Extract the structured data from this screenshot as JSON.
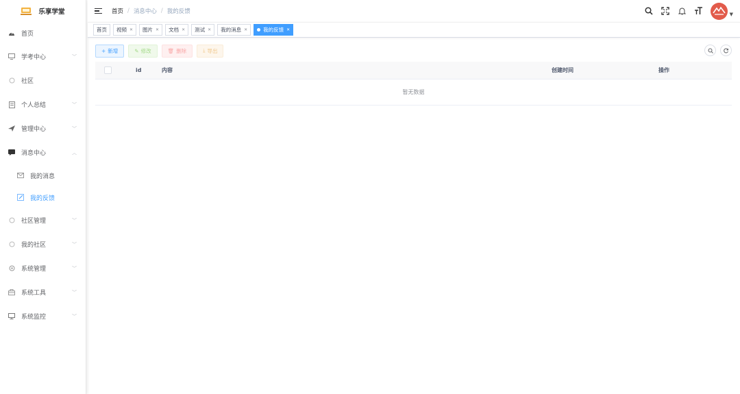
{
  "app": {
    "title": "乐享学堂"
  },
  "sidebar": {
    "items": [
      {
        "label": "首页",
        "icon": "dashboard-icon"
      },
      {
        "label": "学考中心",
        "icon": "monitor-icon"
      },
      {
        "label": "社区",
        "icon": "circle-icon"
      },
      {
        "label": "个人总结",
        "icon": "document-icon"
      },
      {
        "label": "管理中心",
        "icon": "send-icon"
      },
      {
        "label": "消息中心",
        "icon": "message-icon"
      },
      {
        "label": "社区管理",
        "icon": "circle-icon"
      },
      {
        "label": "我的社区",
        "icon": "circle-icon"
      },
      {
        "label": "系统管理",
        "icon": "settings-icon"
      },
      {
        "label": "系统工具",
        "icon": "toolbox-icon"
      },
      {
        "label": "系统监控",
        "icon": "monitor-icon"
      }
    ],
    "sub_items": [
      {
        "label": "我的消息",
        "icon": "mail-icon"
      },
      {
        "label": "我的反馈",
        "icon": "edit-icon"
      }
    ]
  },
  "header": {
    "breadcrumb": [
      "首页",
      "消息中心",
      "我的反馈"
    ],
    "separator": "/"
  },
  "tags": [
    {
      "label": "首页",
      "closable": false
    },
    {
      "label": "视频",
      "closable": true
    },
    {
      "label": "图片",
      "closable": true
    },
    {
      "label": "文档",
      "closable": true
    },
    {
      "label": "测试",
      "closable": true
    },
    {
      "label": "我的消息",
      "closable": true
    },
    {
      "label": "我的反馈",
      "closable": true,
      "active": true
    }
  ],
  "toolbar": {
    "add": "新增",
    "edit": "修改",
    "delete": "删除",
    "export": "导出"
  },
  "table": {
    "columns": [
      "id",
      "内容",
      "创建时间",
      "操作"
    ],
    "empty_text": "暂无数据"
  },
  "colors": {
    "primary": "#409eff",
    "avatar": "#e25b4b"
  }
}
